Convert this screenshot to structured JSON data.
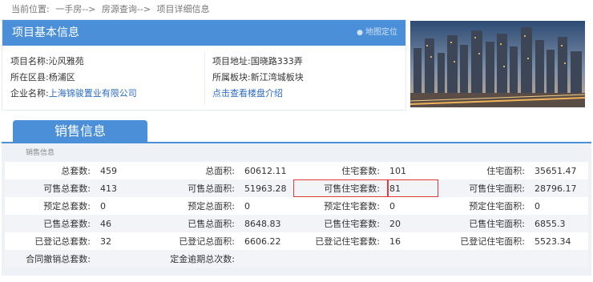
{
  "breadcrumb": [
    "当前位置:",
    "一手房-->",
    "房源查询-->",
    "项目详细信息"
  ],
  "project": {
    "title": "项目基本信息",
    "map_link": "地图定位",
    "name_label": "项目名称:",
    "name": "沁风雅苑",
    "district_label": "所在区县:",
    "district": "杨浦区",
    "company_label": "企业名称:",
    "company": "上海锦骏置业有限公司",
    "address_label": "项目地址:",
    "address": "国晓路333弄",
    "block_label": "所属板块:",
    "block": "新江湾城板块",
    "intro_link": "点击查看楼盘介绍"
  },
  "sales": {
    "tab": "销售信息",
    "subtitle": "销售信息",
    "rows": [
      [
        {
          "l": "总套数:",
          "v": "459"
        },
        {
          "l": "总面积:",
          "v": "60612.11"
        },
        {
          "l": "住宅套数:",
          "v": "101"
        },
        {
          "l": "住宅面积:",
          "v": "35651.47"
        }
      ],
      [
        {
          "l": "可售总套数:",
          "v": "413"
        },
        {
          "l": "可售总面积:",
          "v": "51963.28"
        },
        {
          "l": "可售住宅套数:",
          "v": "81"
        },
        {
          "l": "可售住宅面积:",
          "v": "28796.17"
        }
      ],
      [
        {
          "l": "预定总套数:",
          "v": "0"
        },
        {
          "l": "预定总面积:",
          "v": "0"
        },
        {
          "l": "预定住宅套数:",
          "v": "0"
        },
        {
          "l": "预定住宅面积:",
          "v": "0"
        }
      ],
      [
        {
          "l": "已售总套数:",
          "v": "46"
        },
        {
          "l": "已售总面积:",
          "v": "8648.83"
        },
        {
          "l": "已售住宅套数:",
          "v": "20"
        },
        {
          "l": "已售住宅面积:",
          "v": "6855.3"
        }
      ],
      [
        {
          "l": "已登记总套数:",
          "v": "32"
        },
        {
          "l": "已登记总面积:",
          "v": "6606.22"
        },
        {
          "l": "已登记住宅套数:",
          "v": "16"
        },
        {
          "l": "已登记住宅面积:",
          "v": "5523.34"
        }
      ],
      [
        {
          "l": "合同撤销总套数:",
          "v": ""
        },
        {
          "l": "定金逾期总次数:",
          "v": ""
        },
        {
          "l": "",
          "v": ""
        },
        {
          "l": "",
          "v": ""
        }
      ]
    ]
  }
}
